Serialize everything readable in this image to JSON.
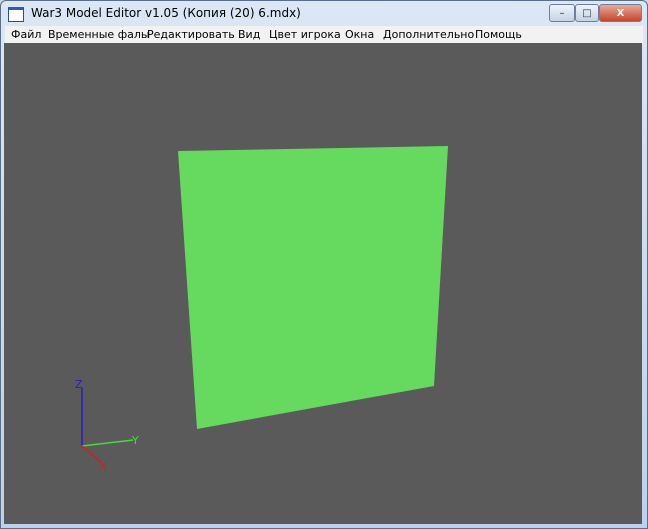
{
  "window": {
    "title": "War3 Model Editor v1.05 (Копия (20) 6.mdx)",
    "minimize": "–",
    "maximize": "□",
    "close": "X"
  },
  "menu": [
    "Файл",
    "Временные фалы",
    "Редактировать",
    "Вид",
    "Цвет игрока",
    "Окна",
    "Дополнительно",
    "Помощь"
  ],
  "viewport": {
    "background": "#5a5a5a",
    "mesh_color": "#66d95f",
    "axes": {
      "z": "Z",
      "y": "Y",
      "x": "X"
    }
  }
}
